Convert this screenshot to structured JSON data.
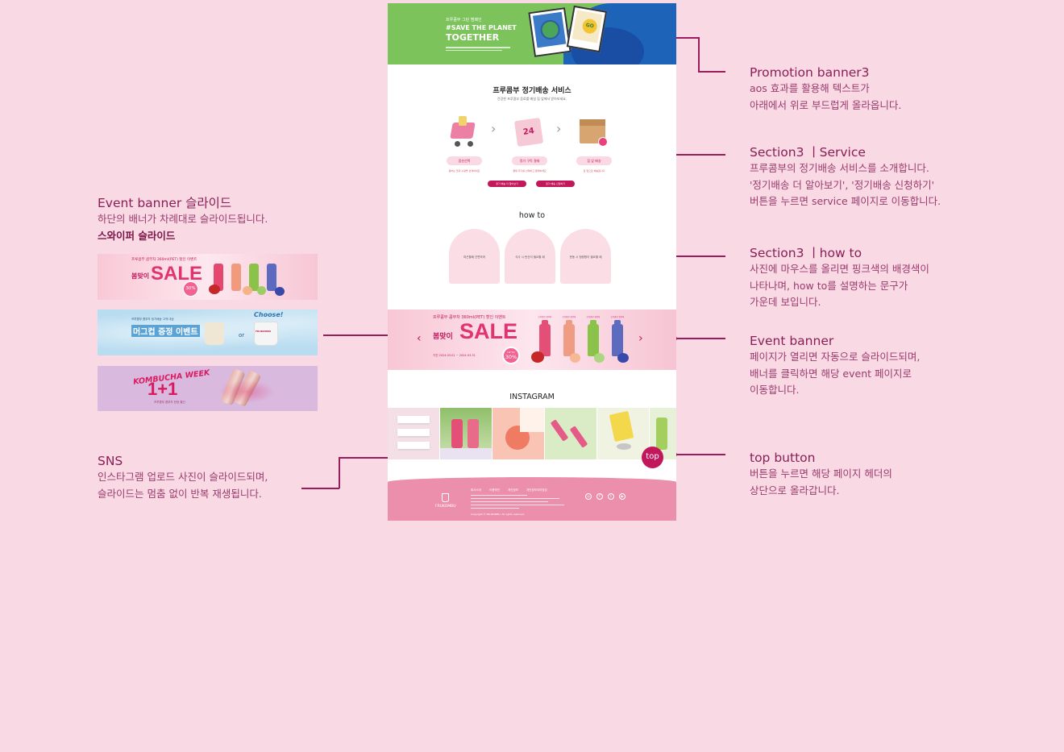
{
  "annotations": {
    "promotion": {
      "title": "Promotion banner3",
      "lines": [
        "aos 효과를 활용해 텍스트가",
        "아래에서 위로 부드럽게 올라옵니다."
      ]
    },
    "service": {
      "title": "Section3 ㅣService",
      "lines": [
        "프루콤부의 정기배송 서비스를 소개합니다.",
        "'정기배송 더 알아보기', '정기배송 신청하기'",
        "버튼을 누르면 service 페이지로 이동합니다."
      ]
    },
    "howto": {
      "title": "Section3 ㅣhow to",
      "lines": [
        "사진에 마우스를 올리면 핑크색의 배경색이",
        "나타나며, how to를 설명하는 문구가",
        "가운데 보입니다."
      ]
    },
    "event": {
      "title": "Event banner",
      "lines": [
        "페이지가 열리면 자동으로 슬라이드되며,",
        "배너를 클릭하면 해당 event 페이지로",
        "이동합니다."
      ]
    },
    "top": {
      "title": "top button",
      "lines": [
        "버튼을 누르면 해당 페이지 헤더의",
        "상단으로 올라갑니다."
      ]
    },
    "event_slide": {
      "title": "Event banner 슬라이드",
      "line": "하단의 배너가 차례대로 슬라이드됩니다.",
      "bold": "스와이퍼 슬라이드"
    },
    "sns": {
      "title": "SNS",
      "lines": [
        "인스타그램 업로드 사진이 슬라이드되며,",
        "슬라이드는 멈춤 없이 반복 재생됩니다."
      ]
    }
  },
  "mockup": {
    "promo": {
      "small": "프루콤부 그린 캠페인",
      "line1": "#SAVE THE PLANET",
      "line2": "TOGETHER",
      "go": "GO"
    },
    "service": {
      "title": "프루콤부 정기배송 서비스",
      "subtitle": "건강한 프루콤부 음료를 매일 집 앞에서 받아보세요.",
      "calendar": "24",
      "steps": [
        {
          "label": "옵션선택",
          "desc": "원하는 맛과 수량을 선택하세요"
        },
        {
          "label": "정기 구독 결제",
          "desc": "결제 주기를 선택하고 결제하세요"
        },
        {
          "label": "집 앞 배송",
          "desc": "집 앞으로 배송됩니다"
        }
      ],
      "btn_more": "정기 배송 더 알아보기",
      "btn_apply": "정기 배송 신청하기"
    },
    "howto": {
      "title": "how to",
      "items": [
        "피곤할때 간편하게",
        "식사 시 탄산이 필요할 때",
        "운동 시 청량함이 필요할 때"
      ]
    },
    "event": {
      "top": "프루콤부 콤부차 360ml(PET) 할인 이벤트",
      "spring": "봄맞이",
      "sale": "SALE",
      "date": "기간 2024.03.01 ~ 2024.03.31",
      "badge_top": "UP TO",
      "badge": "30%",
      "prev": "‹",
      "next": "›",
      "bottle_labels": [
        "프루콤부 콤부차",
        "프루콤부 콤부차",
        "프루콤부 콤부차",
        "프루콤부 콤부차"
      ]
    },
    "instagram": {
      "title": "INSTAGRAM"
    },
    "top_button": "top",
    "footer": {
      "logo": "FRUKOMBU",
      "menu": [
        "회사소개",
        "이용약관",
        "개인정보",
        "개인정보처리방침"
      ],
      "copyright": "Copyright © FRUKOMBU. All rights reserved.",
      "sns": [
        "◎",
        "f",
        "t",
        "▶"
      ]
    }
  },
  "side_banners": {
    "sale": {
      "top": "프루콤부 콤부차 360ml(PET) 할인 이벤트",
      "spring": "봄맞이",
      "sale": "SALE",
      "badge": "30%"
    },
    "mug": {
      "small": "프루콤부 콤부차 정기배송 고객 대상",
      "title": "머그컵 증정 이벤트",
      "or": "or",
      "choose": "Choose!",
      "mug_text": "FRUKOMBU"
    },
    "kombucha": {
      "title": "KOMBUCHA WEEK",
      "big": "1+1",
      "sub": "프루콤부 콤부차 한정 할인"
    }
  },
  "colors": {
    "background": "#f8d9e4",
    "accent": "#9b1c5c",
    "brand_pink": "#c2185b",
    "footer": "#ec8fad"
  }
}
